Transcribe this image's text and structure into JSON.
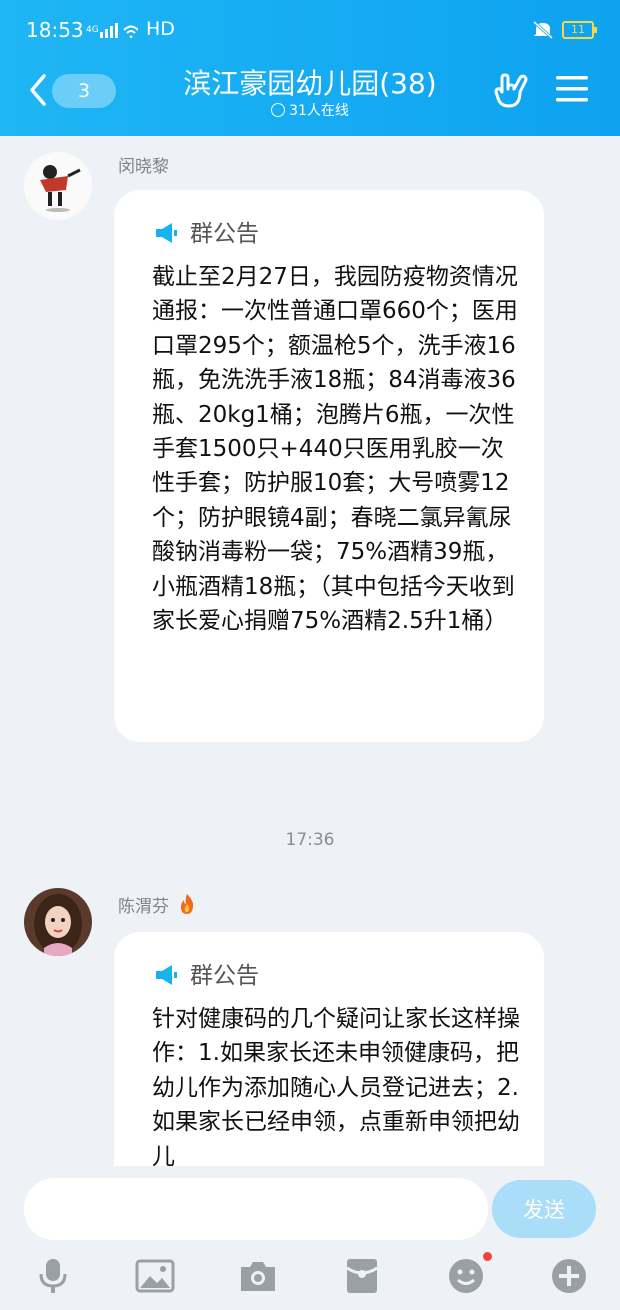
{
  "status": {
    "time": "18:53",
    "signal_text": "4G",
    "hd": "HD",
    "battery": "11"
  },
  "header": {
    "back_count": "3",
    "title": "滨江豪园幼儿园(38)",
    "online": "31人在线"
  },
  "messages": [
    {
      "sender": "闵晓黎",
      "notice_label": "群公告",
      "text": "截止至2月27日，我园防疫物资情况通报：一次性普通口罩660个；医用口罩295个；额温枪5个，洗手液16瓶，免洗洗手液18瓶；84消毒液36瓶、20kg1桶；泡腾片6瓶，一次性手套1500只+440只医用乳胶一次性手套；防护服10套；大号喷雾12个；防护眼镜4副；春晓二氯异氰尿酸钠消毒粉一袋；75%酒精39瓶，小瓶酒精18瓶；（其中包括今天收到家长爱心捐赠75%酒精2.5升1桶）"
    },
    {
      "sender": "陈渭芬",
      "notice_label": "群公告",
      "text": "针对健康码的几个疑问让家长这样操作：1.如果家长还未申领健康码，把幼儿作为添加随心人员登记进去；2.如果家长已经申领，点重新申领把幼儿"
    }
  ],
  "timestamp": "17:36",
  "input": {
    "placeholder": "",
    "send_label": "发送"
  },
  "toolbar": [
    "mic-icon",
    "image-icon",
    "camera-icon",
    "red-packet-icon",
    "emoji-icon",
    "plus-icon"
  ],
  "colors": {
    "header": "#12a9f2",
    "accent": "#1ab0f0",
    "send_disabled": "#a9ddf8",
    "badge": "#f44336"
  }
}
